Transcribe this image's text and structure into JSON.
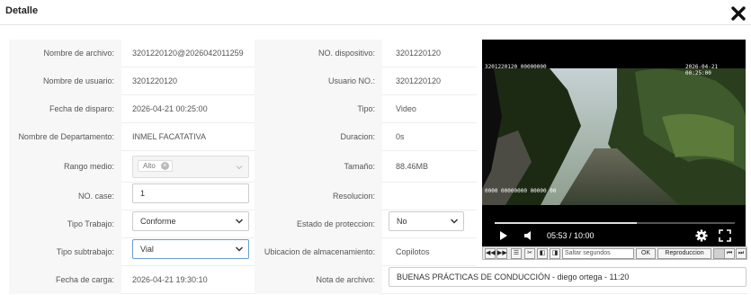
{
  "dialog": {
    "title": "Detalle"
  },
  "fields": {
    "nombre_archivo": {
      "label": "Nombre de archivo:",
      "value": "3201220120@2026042011259"
    },
    "no_dispositivo": {
      "label": "NO. dispositivo:",
      "value": "3201220120"
    },
    "nombre_usuario": {
      "label": "Nombre de usuario:",
      "value": "3201220120"
    },
    "usuario_no": {
      "label": "Usuario NO.:",
      "value": "3201220120"
    },
    "fecha_disparo": {
      "label": "Fecha de disparo:",
      "value": "2026-04-21 00:25:00"
    },
    "tipo": {
      "label": "Tipo:",
      "value": "Video"
    },
    "departamento": {
      "label": "Nombre de Departamento:",
      "value": "INMEL FACATATIVA"
    },
    "duracion": {
      "label": "Duracion:",
      "value": "0s"
    },
    "rango_medio": {
      "label": "Rango medio:",
      "value": "Alto"
    },
    "tamano": {
      "label": "Tamaño:",
      "value": "88.46MB"
    },
    "no_case": {
      "label": "NO. case:",
      "value": "1"
    },
    "resolucion": {
      "label": "Resolucion:",
      "value": ""
    },
    "tipo_trabajo": {
      "label": "Tipo Trabajo:",
      "value": "Conforme"
    },
    "estado_proteccion": {
      "label": "Estado de proteccion:",
      "value": "No"
    },
    "tipo_subtrabajo": {
      "label": "Tipo subtrabajo:",
      "value": "Vial"
    },
    "ubicacion": {
      "label": "Ubicacion de almacenamiento:",
      "value": "Copilotos"
    },
    "fecha_carga": {
      "label": "Fecha de carga:",
      "value": "2026-04-21 19:30:10"
    },
    "nota_archivo": {
      "label": "Nota de archivo:",
      "value": "BUENAS PRÁCTICAS DE CONDUCCIÓN - diego ortega - 11:20"
    }
  },
  "player": {
    "time": "05:53 / 10:00",
    "progress": 0.59,
    "osd_top_left": "3201220120 00000000",
    "osd_top_right": "2026-04-21 00:25:00",
    "osd_mid_left": "0000 00000000 00000 00",
    "skip_placeholder": "Saltar segundos",
    "ok_label": "OK",
    "reproduccion_label": "Reproduccion"
  },
  "colors": {
    "accent": "#1f6fc5",
    "focus_border": "#6a9cd6"
  }
}
